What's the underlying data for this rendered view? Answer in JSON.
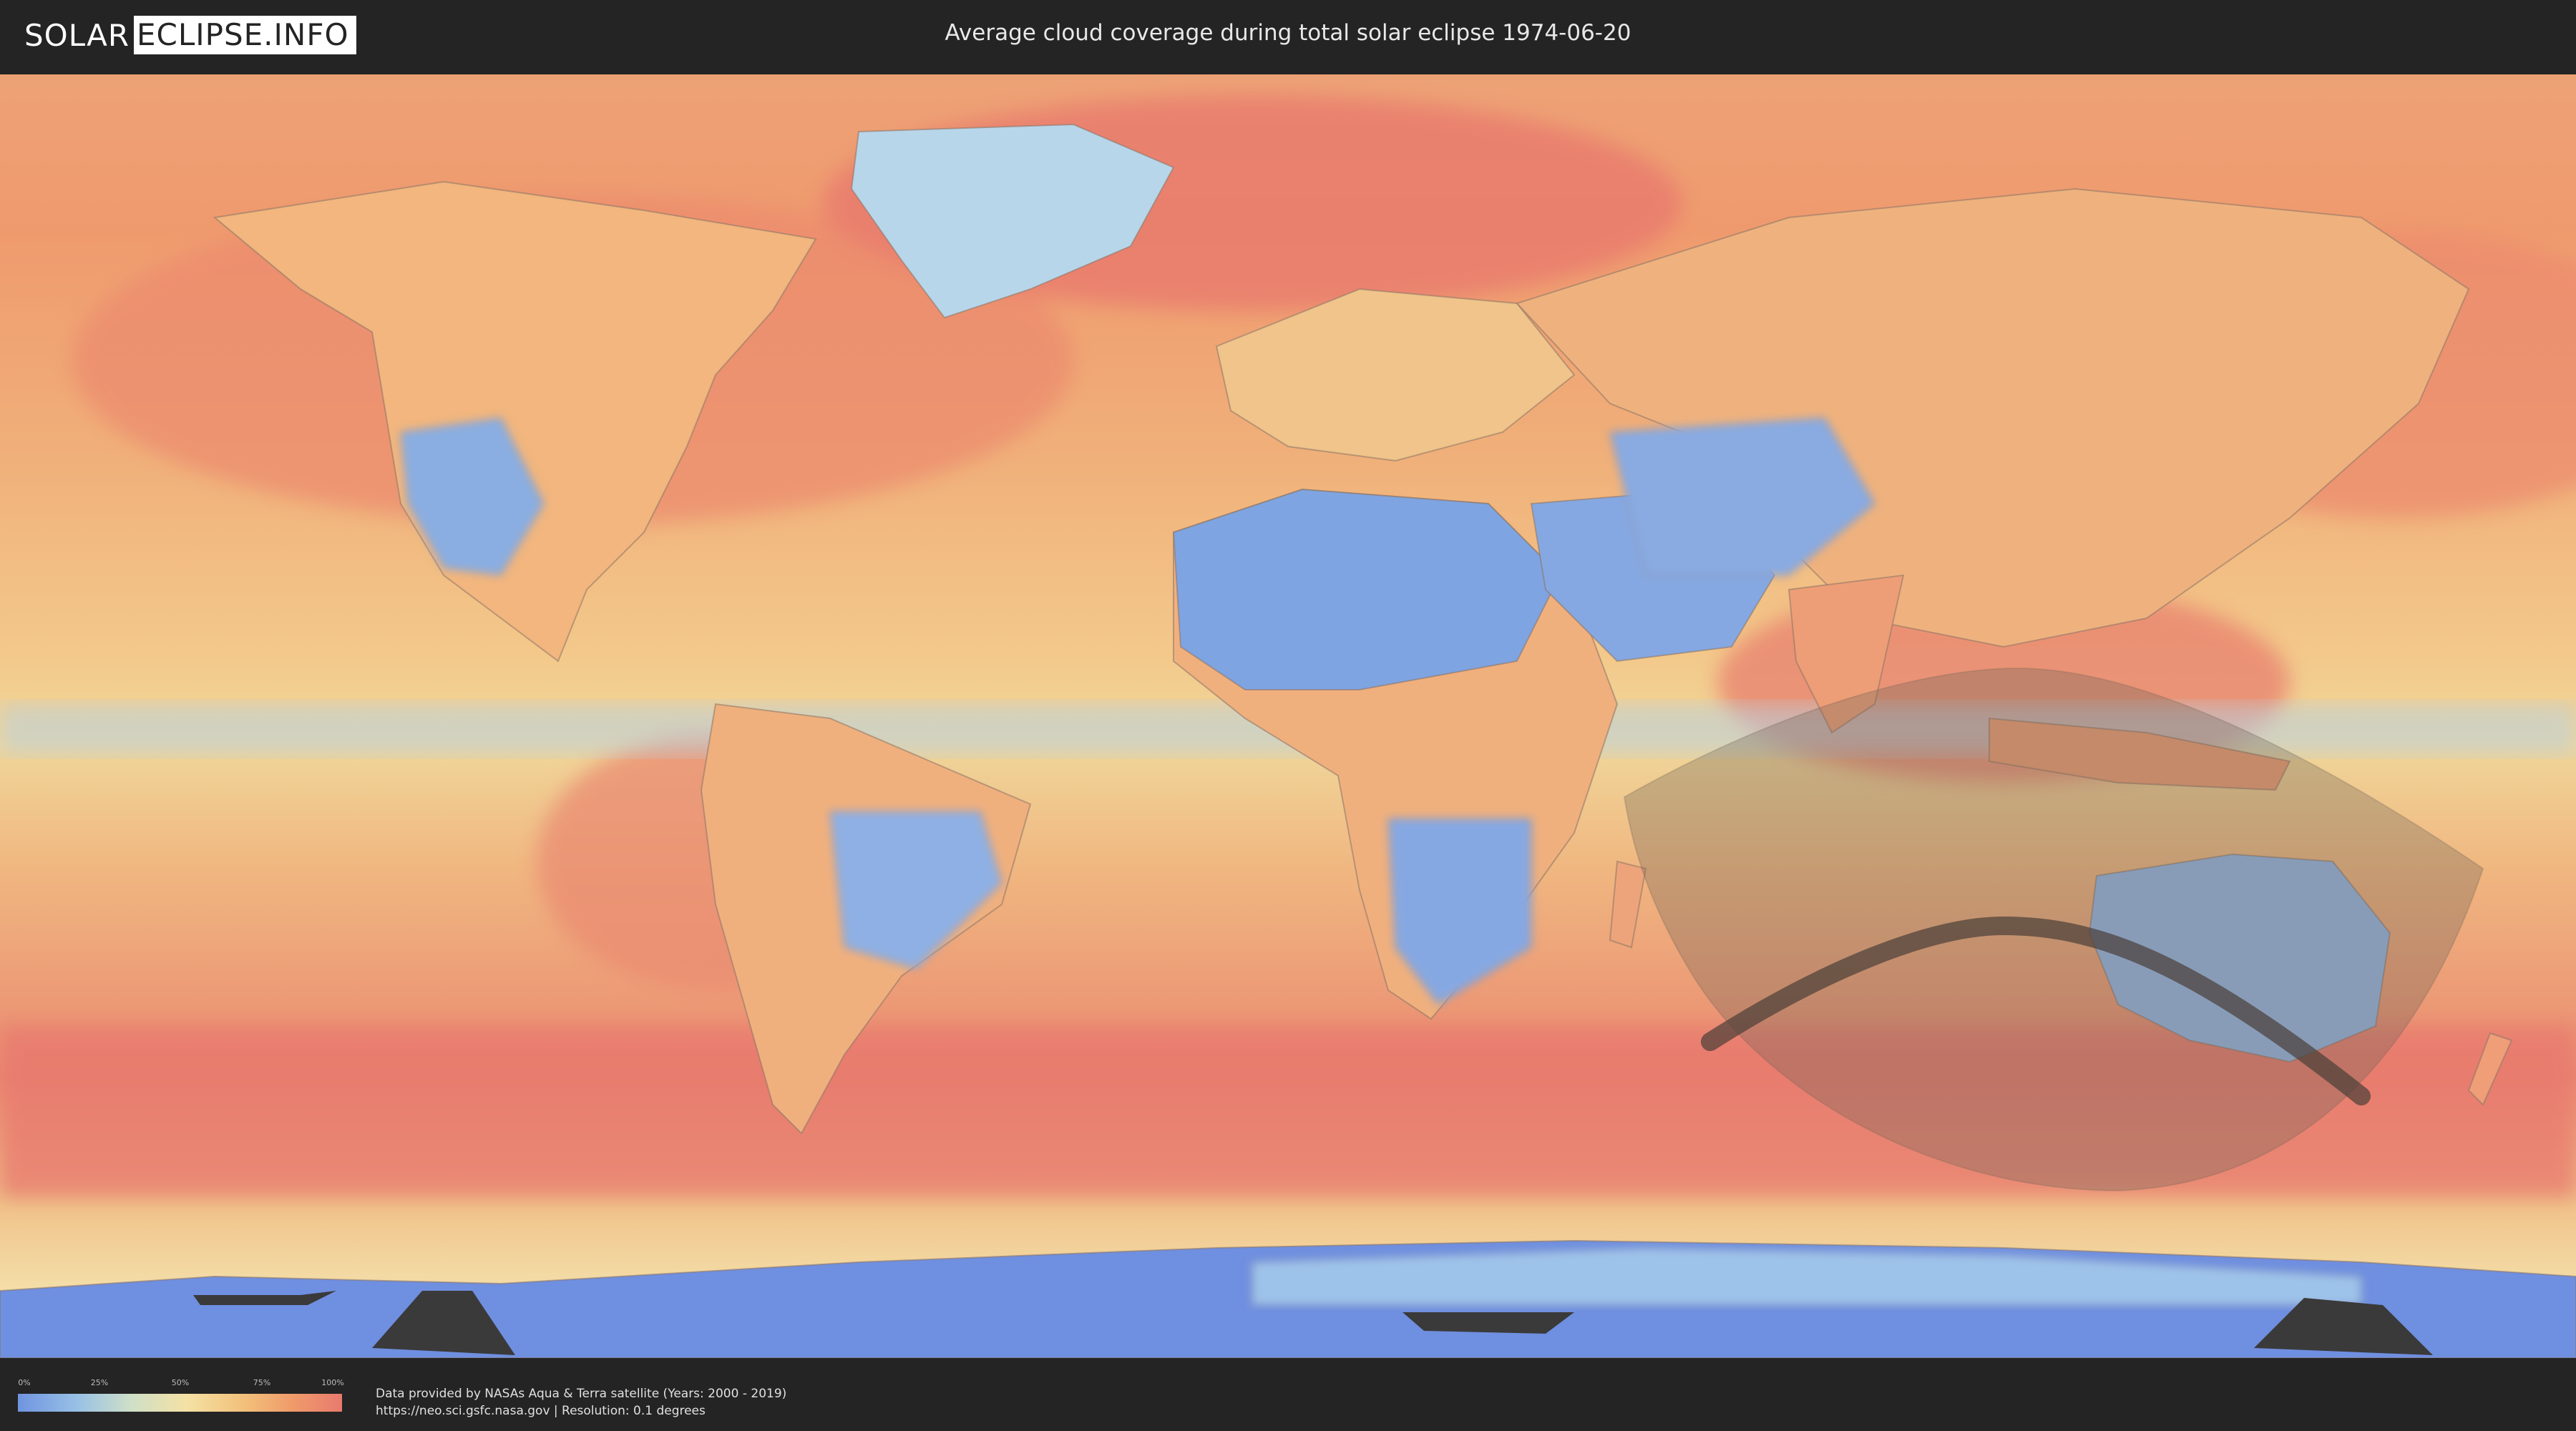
{
  "header": {
    "logo_solar": "SOLAR",
    "logo_eclipse": "ECLIPSE.INFO",
    "title": "Average cloud coverage during total solar eclipse 1974-06-20"
  },
  "map": {
    "colors": {
      "clear": "#6f94e0",
      "partly": "#f4e1a4",
      "cloudy": "#e97a6e",
      "eclipse_zone": "#7a6a52",
      "path_of_totality": "#4a3f38"
    }
  },
  "legend": {
    "ticks": [
      "0%",
      "25%",
      "50%",
      "75%",
      "100%"
    ]
  },
  "footer": {
    "credit_line1": "Data provided by NASAs Aqua & Terra satellite (Years: 2000 - 2019)",
    "credit_line2": "https://neo.sci.gsfc.nasa.gov | Resolution: 0.1 degrees"
  }
}
